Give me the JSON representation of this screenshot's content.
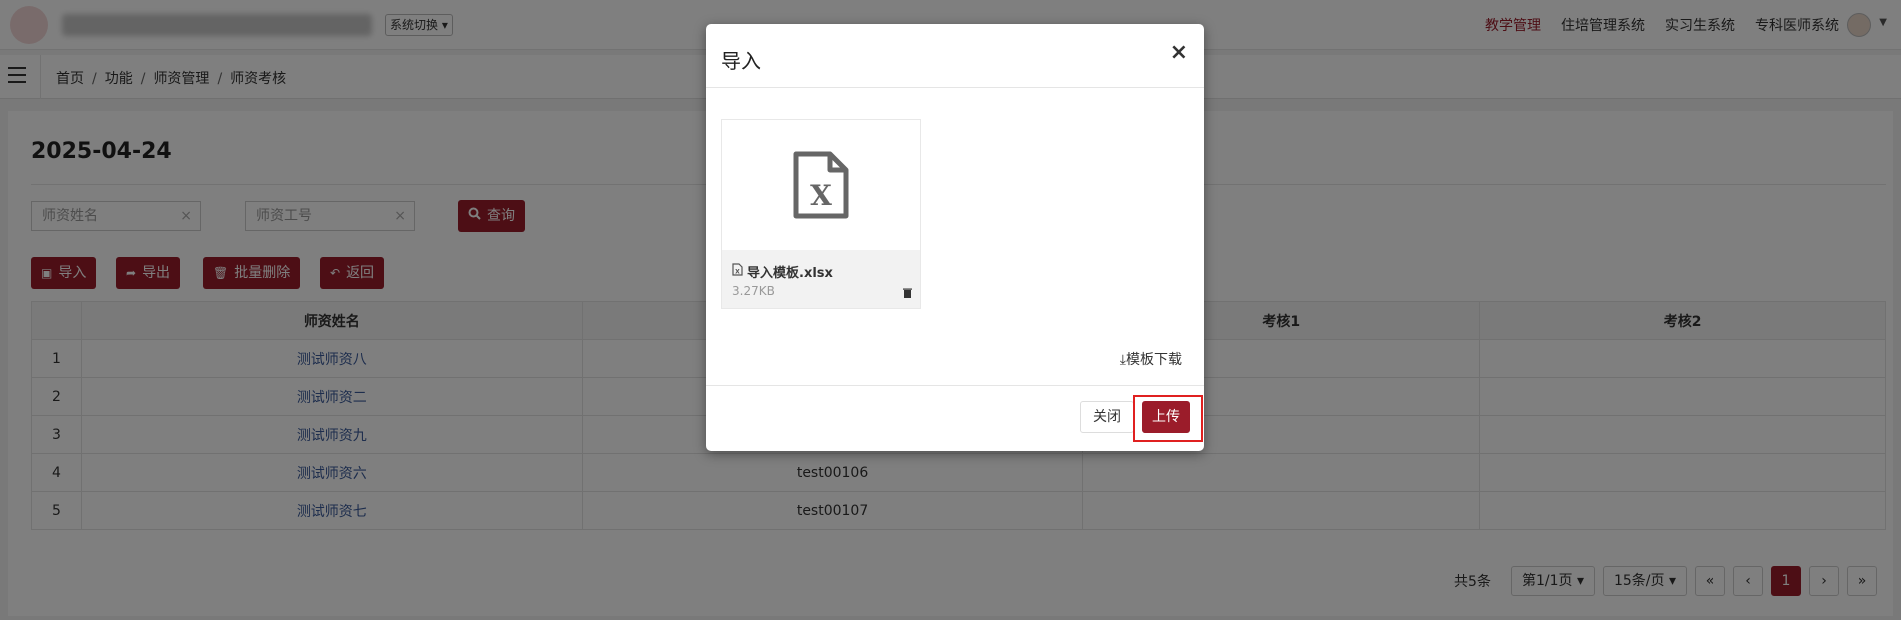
{
  "topnav": {
    "system_switch": "系统切换",
    "menu": [
      "教学管理",
      "住培管理系统",
      "实习生系统",
      "专科医师系统"
    ]
  },
  "breadcrumb": [
    "首页",
    "功能",
    "师资管理",
    "师资考核"
  ],
  "page": {
    "date_title": "2025-04-24",
    "search_name_placeholder": "师资姓名",
    "search_id_placeholder": "师资工号",
    "clear_icon": "×",
    "query_label": "查询",
    "toolbar": {
      "import_label": "导入",
      "export_label": "导出",
      "batch_delete_label": "批量删除",
      "back_label": "返回"
    }
  },
  "table": {
    "columns": [
      "",
      "师资姓名",
      "",
      "考核1",
      "考核2"
    ],
    "rows": [
      {
        "idx": "1",
        "name": "测试师资八",
        "id": "",
        "k1": "",
        "k2": ""
      },
      {
        "idx": "2",
        "name": "测试师资二",
        "id": "",
        "k1": "",
        "k2": ""
      },
      {
        "idx": "3",
        "name": "测试师资九",
        "id": "",
        "k1": "",
        "k2": ""
      },
      {
        "idx": "4",
        "name": "测试师资六",
        "id": "test00106",
        "k1": "",
        "k2": ""
      },
      {
        "idx": "5",
        "name": "测试师资七",
        "id": "test00107",
        "k1": "",
        "k2": ""
      }
    ]
  },
  "pager": {
    "total": "共5条",
    "page_info": "第1/1页",
    "page_size": "15条/页",
    "first": "«",
    "prev": "‹",
    "current": "1",
    "next": "›",
    "last": "»"
  },
  "modal": {
    "title": "导入",
    "close_x": "×",
    "file_name": "导入模板.xlsx",
    "file_size": "3.27KB",
    "template_download": "模板下载",
    "close_button": "关闭",
    "upload_button": "上传"
  },
  "colors": {
    "brand": "#9b1c2a",
    "link": "#3a5a9a",
    "highlight": "#e02020"
  },
  "icons": [
    "hamburger-icon",
    "search-icon",
    "import-icon",
    "export-icon",
    "trash-icon",
    "back-icon",
    "excel-file-icon",
    "download-icon",
    "close-icon"
  ]
}
